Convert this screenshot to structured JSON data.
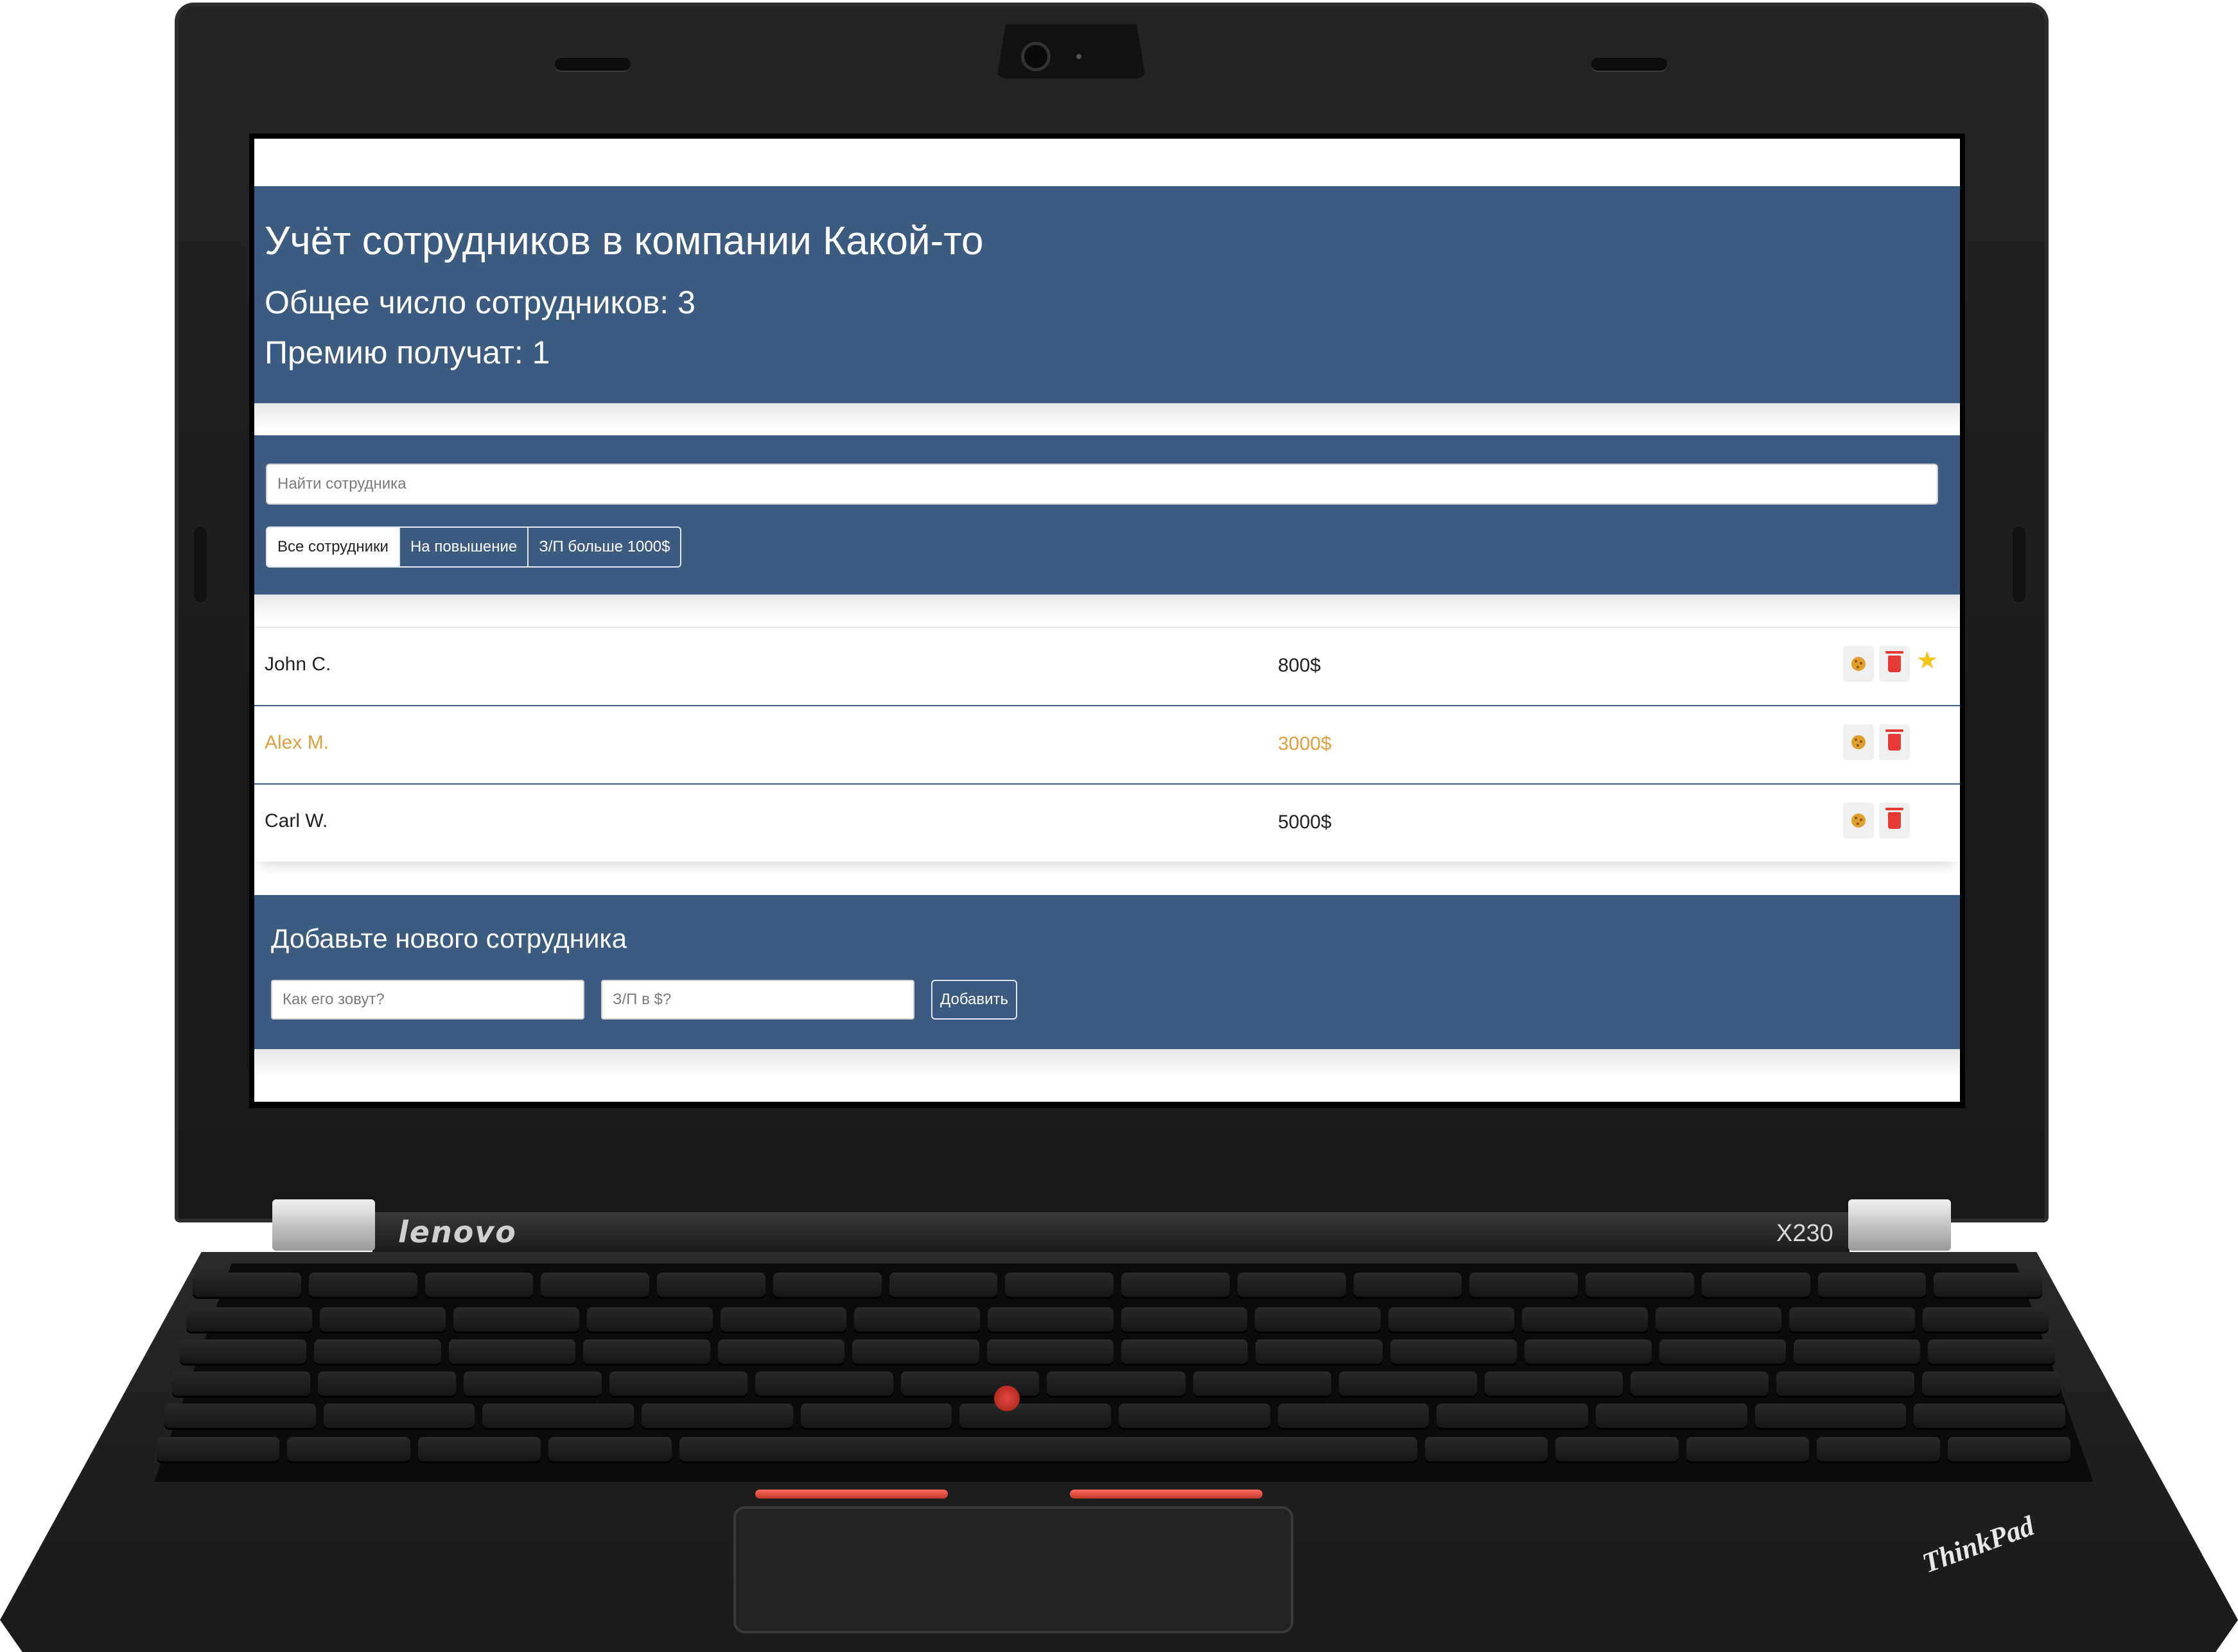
{
  "device": {
    "brand": "lenovo",
    "model": "X230",
    "logo": "ThinkPad"
  },
  "app": {
    "title": "Учёт сотрудников в компании Какой-то",
    "total_employees": "Общее число сотрудников: 3",
    "bonus_count": "Премию получат: 1"
  },
  "search": {
    "placeholder": "Найти сотрудника"
  },
  "filters": [
    {
      "label": "Все сотрудники",
      "active": true
    },
    {
      "label": "На повышение",
      "active": false
    },
    {
      "label": "З/П больше 1000$",
      "active": false
    }
  ],
  "employees": [
    {
      "name": "John C.",
      "salary": "800$",
      "increase": false,
      "rise": true
    },
    {
      "name": "Alex M.",
      "salary": "3000$",
      "increase": true,
      "rise": false
    },
    {
      "name": "Carl W.",
      "salary": "5000$",
      "increase": false,
      "rise": false
    }
  ],
  "add_form": {
    "title": "Добавьте нового сотрудника",
    "name_placeholder": "Как его зовут?",
    "salary_placeholder": "З/П в $?",
    "submit_label": "Добавить"
  },
  "colors": {
    "panel": "#3d5a80",
    "increase_text": "#e09f3e",
    "star": "#f5c518",
    "trash": "#e53935"
  },
  "icons": {
    "cookie": "cookie-icon",
    "trash": "trash-icon",
    "star": "star-icon"
  }
}
